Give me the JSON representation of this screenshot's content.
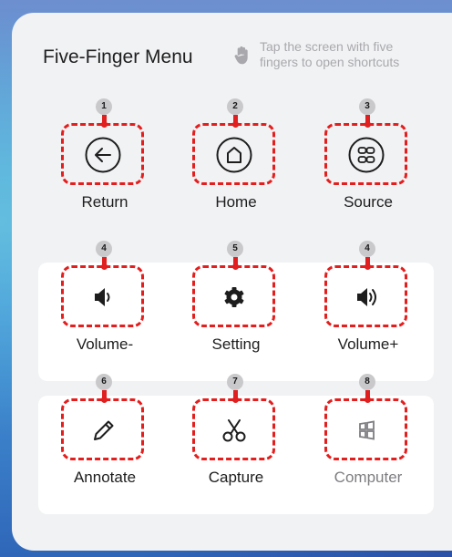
{
  "header": {
    "title": "Five-Finger Menu",
    "hint_line1": "Tap the screen with five",
    "hint_line2": "fingers to open shortcuts",
    "hint_icon": "hand-tap-icon"
  },
  "rows": [
    {
      "items": [
        {
          "id": "return",
          "badge": "1",
          "label": "Return",
          "icon": "return-arrow-icon",
          "enabled": true
        },
        {
          "id": "home",
          "badge": "2",
          "label": "Home",
          "icon": "home-icon",
          "enabled": true
        },
        {
          "id": "source",
          "badge": "3",
          "label": "Source",
          "icon": "source-icon",
          "enabled": true
        }
      ]
    },
    {
      "items": [
        {
          "id": "volume-down",
          "badge": "4",
          "label": "Volume-",
          "icon": "volume-down-icon",
          "enabled": true
        },
        {
          "id": "setting",
          "badge": "5",
          "label": "Setting",
          "icon": "gear-icon",
          "enabled": true
        },
        {
          "id": "volume-up",
          "badge": "4",
          "label": "Volume+",
          "icon": "volume-up-icon",
          "enabled": true
        }
      ]
    },
    {
      "items": [
        {
          "id": "annotate",
          "badge": "6",
          "label": "Annotate",
          "icon": "pen-icon",
          "enabled": true
        },
        {
          "id": "capture",
          "badge": "7",
          "label": "Capture",
          "icon": "scissors-icon",
          "enabled": true
        },
        {
          "id": "computer",
          "badge": "8",
          "label": "Computer",
          "icon": "windows-icon",
          "enabled": false
        }
      ]
    }
  ],
  "colors": {
    "highlight": "#e41d1d",
    "badge": "#c9c9cc",
    "panel": "#f1f2f4",
    "disabled_text": "#7e7e82"
  }
}
